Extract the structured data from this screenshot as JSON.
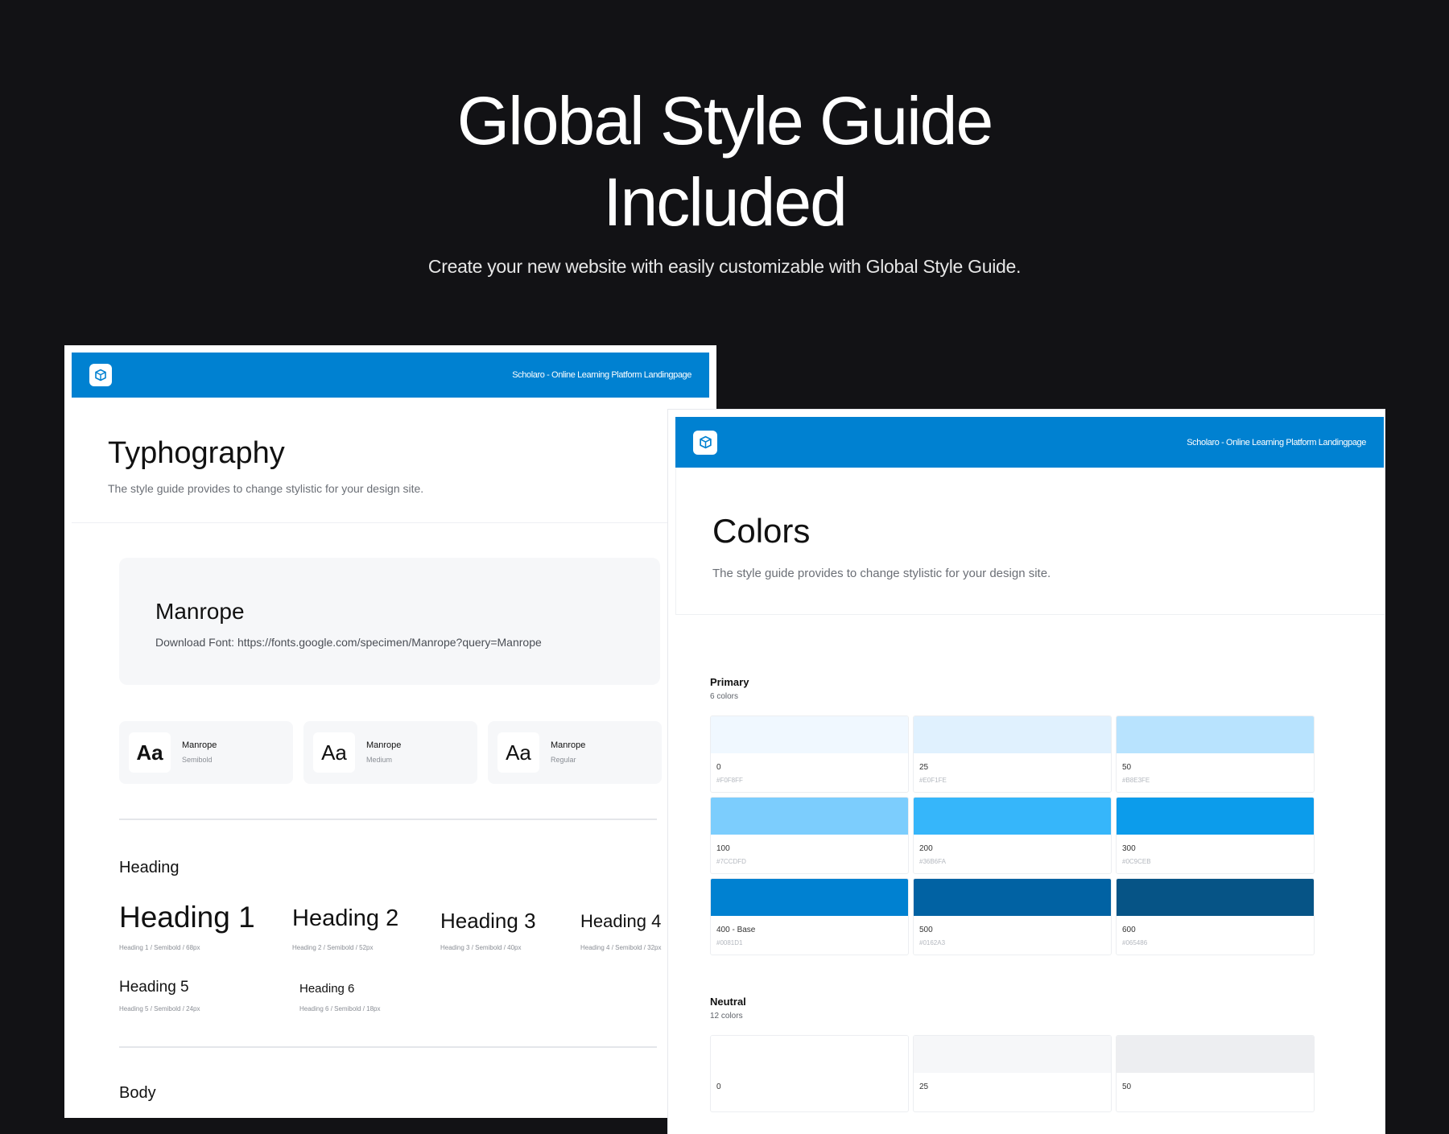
{
  "hero": {
    "title_line1": "Global Style Guide",
    "title_line2": "Included",
    "subtitle": "Create your new website with easily customizable with Global Style Guide."
  },
  "typography_card": {
    "topbar_title": "Scholaro - Online Learning Platform Landingpage",
    "title": "Typhography",
    "description": "The style guide provides to change stylistic for your design site.",
    "font_name": "Manrope",
    "font_link": "Download Font: https://fonts.google.com/specimen/Manrope?query=Manrope",
    "weights": [
      {
        "aa": "Aa",
        "name": "Manrope",
        "weight": "Semibold"
      },
      {
        "aa": "Aa",
        "name": "Manrope",
        "weight": "Medium"
      },
      {
        "aa": "Aa",
        "name": "Manrope",
        "weight": "Regular"
      }
    ],
    "heading_section_label": "Heading",
    "headings": [
      {
        "label": "Heading 1",
        "meta": "Heading 1 / Semibold / 68px"
      },
      {
        "label": "Heading 2",
        "meta": "Heading 2 / Semibold / 52px"
      },
      {
        "label": "Heading 3",
        "meta": "Heading 3 / Semibold / 40px"
      },
      {
        "label": "Heading 4",
        "meta": "Heading 4 / Semibold / 32px"
      },
      {
        "label": "Heading 5",
        "meta": "Heading 5 / Semibold / 24px"
      },
      {
        "label": "Heading 6",
        "meta": "Heading 6 / Semibold / 18px"
      }
    ],
    "body_section_label": "Body"
  },
  "colors_card": {
    "topbar_title": "Scholaro - Online Learning Platform Landingpage",
    "title": "Colors",
    "description": "The style guide provides to change stylistic for your design site.",
    "primary": {
      "label": "Primary",
      "count": "6 colors",
      "swatches": [
        {
          "step": "0",
          "hex": "#F0F8FF",
          "color": "#F0F8FF"
        },
        {
          "step": "25",
          "hex": "#E0F1FE",
          "color": "#E0F1FE"
        },
        {
          "step": "50",
          "hex": "#B8E3FE",
          "color": "#B8E3FE"
        },
        {
          "step": "100",
          "hex": "#7CCDFD",
          "color": "#7CCDFD"
        },
        {
          "step": "200",
          "hex": "#36B6FA",
          "color": "#36B6FA"
        },
        {
          "step": "300",
          "hex": "#0C9CEB",
          "color": "#0C9CEB"
        },
        {
          "step": "400 -  Base",
          "hex": "#0081D1",
          "color": "#0081D1"
        },
        {
          "step": "500",
          "hex": "#0162A3",
          "color": "#0162A3"
        },
        {
          "step": "600",
          "hex": "#065486",
          "color": "#065486"
        }
      ]
    },
    "neutral": {
      "label": "Neutral",
      "count": "12 colors",
      "swatches": [
        {
          "step": "0",
          "color": "#FFFFFF"
        },
        {
          "step": "25",
          "color": "#F6F7F9"
        },
        {
          "step": "50",
          "color": "#EDEEF1"
        }
      ]
    }
  }
}
